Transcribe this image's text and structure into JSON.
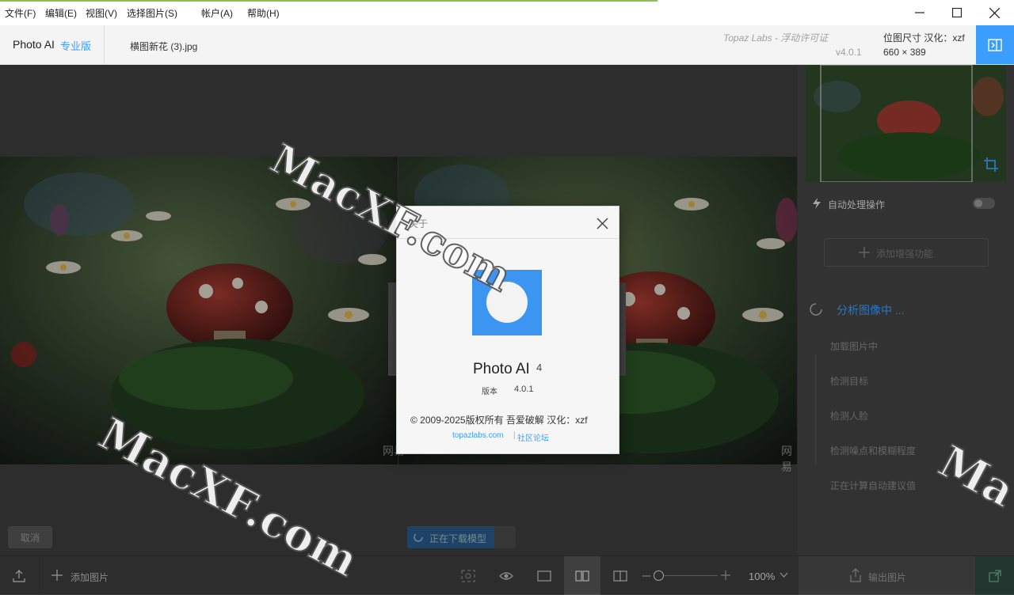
{
  "menu": {
    "items": [
      "文件(F)",
      "编辑(E)",
      "视图(V)",
      "选择图片(S)",
      "帐户(A)",
      "帮助(H)"
    ]
  },
  "header": {
    "app_name": "Photo AI",
    "edition": "专业版",
    "file_name": "横图新花 (3).jpg",
    "license": "Topaz Labs - 浮动许可证",
    "version": "v4.0.1",
    "dims_label": "位图尺寸 汉化：xzf",
    "dims_value": "660 × 389"
  },
  "right_panel": {
    "autopilot_label": "自动处理操作",
    "add_enhance": "添加增强功能",
    "analyzing": "分析图像中 ...",
    "steps": [
      "加载图片中",
      "检测目标",
      "检测人脸",
      "检测噪点和模糊程度",
      "正在计算自动建议值"
    ]
  },
  "canvas": {
    "cancel_label": "取消",
    "download_label": "正在下载模型",
    "watermark_fragment": "网易"
  },
  "bottom": {
    "add_image": "添加图片",
    "zoom": "100%",
    "export": "输出图片"
  },
  "dialog": {
    "title": "关于",
    "product": "Photo AI",
    "major": "4",
    "version_label": "版本",
    "version_value": "4.0.1",
    "copyright": "© 2009-2025版权所有  吾爱破解  汉化：xzf",
    "link_site": "topazlabs.com",
    "link_forum": "社区论坛"
  },
  "watermarks": [
    "MacXF.com",
    "MacXF.com",
    "Ma"
  ],
  "colors": {
    "accent": "#3b9eff",
    "logo_blue": "#3d95f2",
    "menubar_green": "#8bc34a"
  }
}
